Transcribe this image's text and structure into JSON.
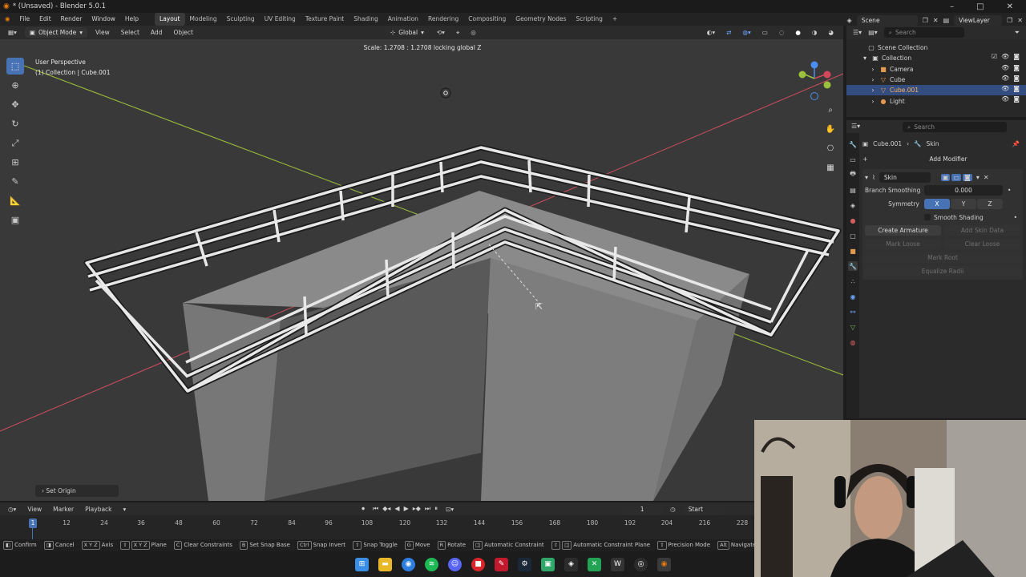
{
  "window": {
    "title": "* (Unsaved) - Blender 5.0.1"
  },
  "menu": {
    "items": [
      "File",
      "Edit",
      "Render",
      "Window",
      "Help"
    ]
  },
  "workspaces": [
    "Layout",
    "Modeling",
    "Sculpting",
    "UV Editing",
    "Texture Paint",
    "Shading",
    "Animation",
    "Rendering",
    "Compositing",
    "Geometry Nodes",
    "Scripting"
  ],
  "scene": {
    "name": "Scene",
    "view_layer": "ViewLayer"
  },
  "viewport_header": {
    "mode": "Object Mode",
    "menus": [
      "View",
      "Select",
      "Add",
      "Object"
    ],
    "orientation": "Global"
  },
  "viewport": {
    "operator_status": "Scale: 1.2708 : 1.2708 locking global Z",
    "perspective": "User Perspective",
    "collection_info": "(1) Collection | Cube.001",
    "last_op": "Set Origin"
  },
  "outliner": {
    "search_placeholder": "Search",
    "root": "Scene Collection",
    "collection": "Collection",
    "items": [
      {
        "name": "Camera",
        "selected": false
      },
      {
        "name": "Cube",
        "selected": false
      },
      {
        "name": "Cube.001",
        "selected": true
      },
      {
        "name": "Light",
        "selected": false
      }
    ]
  },
  "properties": {
    "search_placeholder": "Search",
    "breadcrumb_object": "Cube.001",
    "breadcrumb_modifier": "Skin",
    "add_modifier": "Add Modifier",
    "modifier_name": "Skin",
    "branch_smoothing_label": "Branch Smoothing",
    "branch_smoothing_value": "0.000",
    "symmetry_label": "Symmetry",
    "symmetry_axes": [
      "X",
      "Y",
      "Z"
    ],
    "smooth_shading": "Smooth Shading",
    "create_armature": "Create Armature",
    "add_skin_data": "Add Skin Data",
    "mark_loose": "Mark Loose",
    "clear_loose": "Clear Loose",
    "mark_root": "Mark Root",
    "equalize_radii": "Equalize Radii"
  },
  "timeline": {
    "menus": [
      "View",
      "Marker",
      "Playback"
    ],
    "current_frame": "1",
    "start_label": "Start",
    "ticks": [
      "1",
      "12",
      "24",
      "36",
      "48",
      "60",
      "72",
      "84",
      "96",
      "108",
      "120",
      "132",
      "144",
      "156",
      "168",
      "180",
      "192",
      "204",
      "216",
      "228"
    ]
  },
  "statusbar": {
    "items": [
      {
        "key": "",
        "label": "Confirm"
      },
      {
        "key": "",
        "label": "Cancel"
      },
      {
        "key": "X Y Z",
        "label": "Axis"
      },
      {
        "key": "X Y Z",
        "label": "Plane"
      },
      {
        "key": "C",
        "label": "Clear Constraints"
      },
      {
        "key": "B",
        "label": "Set Snap Base"
      },
      {
        "key": "Ctrl",
        "label": "Snap Invert"
      },
      {
        "key": "",
        "label": "Snap Toggle"
      },
      {
        "key": "G",
        "label": "Move"
      },
      {
        "key": "R",
        "label": "Rotate"
      },
      {
        "key": "",
        "label": "Automatic Constraint"
      },
      {
        "key": "",
        "label": "Automatic Constraint Plane"
      },
      {
        "key": "",
        "label": "Precision Mode"
      },
      {
        "key": "Alt",
        "label": "Navigate"
      }
    ]
  },
  "colors": {
    "accent": "#4772b3",
    "x_axis": "#d4475a",
    "y_axis": "#9bc23a",
    "header": "#2b2b2b",
    "viewport": "#393939"
  }
}
